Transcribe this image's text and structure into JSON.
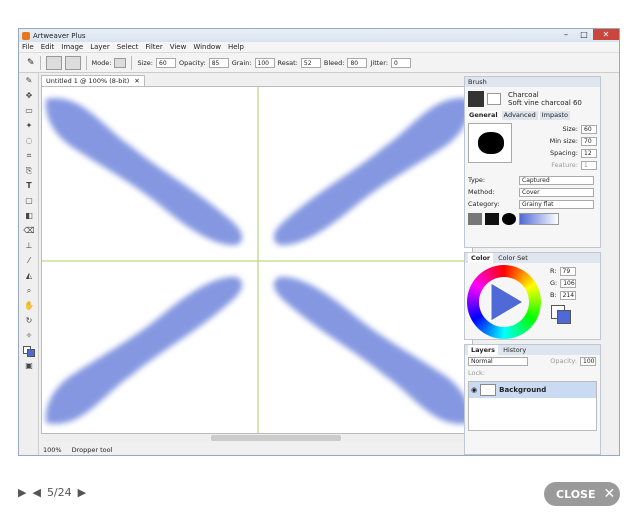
{
  "app": {
    "title": "Artweaver Plus"
  },
  "menu": [
    "File",
    "Edit",
    "Image",
    "Layer",
    "Select",
    "Filter",
    "View",
    "Window",
    "Help"
  ],
  "options": {
    "mode_label": "Mode:",
    "size_label": "Size:",
    "size_val": "60",
    "opacity_label": "Opacity:",
    "opacity_val": "85",
    "grain_label": "Grain:",
    "grain_val": "100",
    "resat_label": "Resat:",
    "resat_val": "52",
    "bleed_label": "Bleed:",
    "bleed_val": "80",
    "jitter_label": "Jitter:",
    "jitter_val": "0"
  },
  "document": {
    "tab": "Untitled 1 @ 100% (8-bit)",
    "zoom": "100%",
    "status": "Dropper tool"
  },
  "brush": {
    "panel_title": "Brush",
    "name": "Charcoal",
    "variant": "Soft vine charcoal 60",
    "tabs": [
      "General",
      "Advanced",
      "Impasto"
    ],
    "size_label": "Size:",
    "size_val": "60",
    "minsize_label": "Min size:",
    "minsize_val": "70",
    "spacing_label": "Spacing:",
    "spacing_val": "12",
    "feature_label": "Feature:",
    "feature_val": "1",
    "type_label": "Type:",
    "type_val": "Captured",
    "method_label": "Method:",
    "method_val": "Cover",
    "category_label": "Category:",
    "category_val": "Grainy flat"
  },
  "color": {
    "tabs": [
      "Color",
      "Color Set"
    ],
    "r_label": "R:",
    "r_val": "79",
    "g_label": "G:",
    "g_val": "106",
    "b_label": "B:",
    "b_val": "214",
    "swatch": "#4f6ad6"
  },
  "layers": {
    "tabs": [
      "Layers",
      "History"
    ],
    "blend": "Normal",
    "opacity_label": "Opacity:",
    "opacity_val": "100",
    "lock_label": "Lock:",
    "layer_name": "Background"
  },
  "footer": {
    "counter": "5/24",
    "close_label": "CLOSE"
  }
}
